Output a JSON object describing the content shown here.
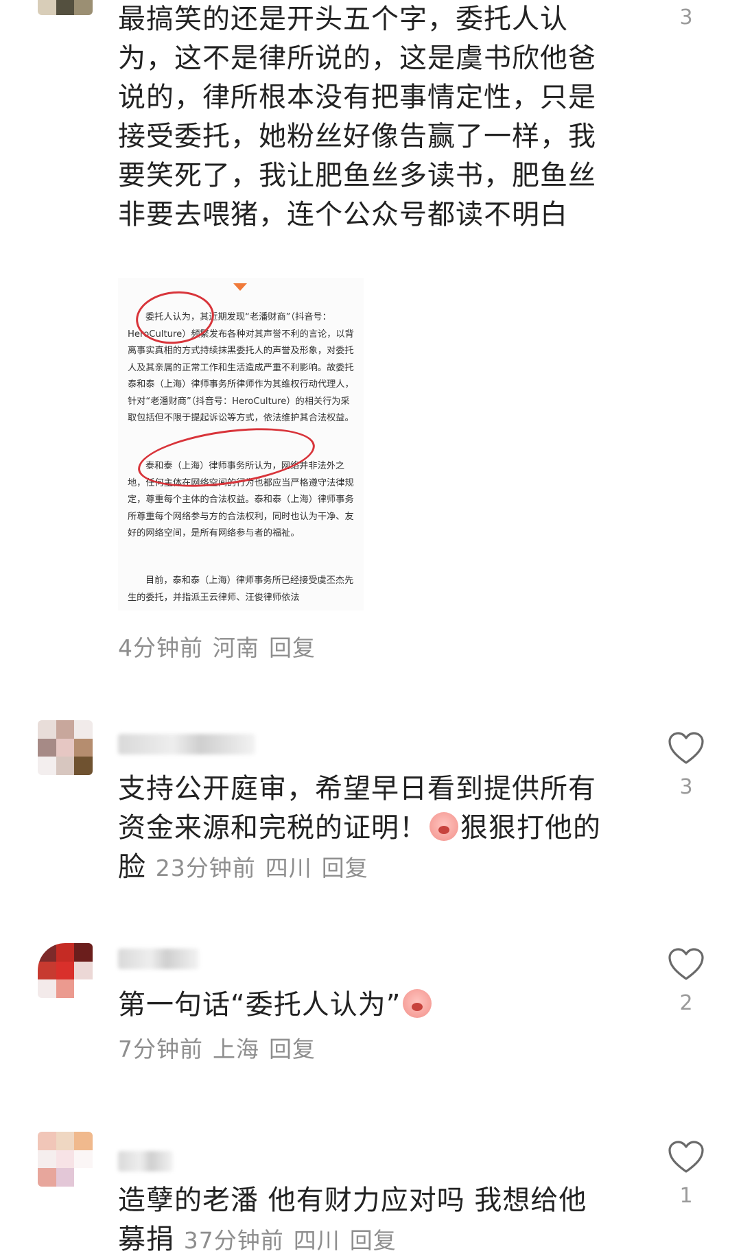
{
  "comments": [
    {
      "text": "最搞笑的还是开头五个字，委托人认为，这不是律所说的，这是虞书欣他爸说的，律所根本没有把事情定性，只是接受委托，她粉丝好像告赢了一样，我要笑死了，我让肥鱼丝多读书，肥鱼丝非要去喂猪，连个公众号都读不明白",
      "likes": "3",
      "time": "4分钟前",
      "location": "河南",
      "reply": "回复"
    },
    {
      "text_before": "支持公开庭审，希望早日看到提供所有资金来源和完税的证明！",
      "emoji": "angry-face-emoji",
      "text_after": "狠狠打他的脸",
      "likes": "3",
      "time": "23分钟前",
      "location": "四川",
      "reply": "回复"
    },
    {
      "text": "第一句话“委托人认为”",
      "emoji": "crying-face-emoji",
      "likes": "2",
      "time": "7分钟前",
      "location": "上海",
      "reply": "回复"
    },
    {
      "text": "造孽的老潘 他有财力应对吗 我想给他募捐",
      "likes": "1",
      "time": "37分钟前",
      "location": "四川",
      "reply": "回复"
    }
  ],
  "attached_image": {
    "paragraphs": [
      "委托人认为，其近期发现“老潘财商”（抖音号：HeroCulture）频繁发布各种对其声誉不利的言论，以背离事实真相的方式持续抹黑委托人的声誉及形象，对委托人及其亲属的正常工作和生活造成严重不利影响。故委托泰和泰（上海）律师事务所律师作为其维权行动代理人，针对“老潘财商”（抖音号：HeroCulture）的相关行为采取包括但不限于提起诉讼等方式，依法维护其合法权益。",
      "泰和泰（上海）律师事务所认为，网络并非法外之地，任何主体在网络空间的行为也都应当严格遵守法律规定，尊重每个主体的合法权益。泰和泰（上海）律师事务所尊重每个网络参与方的合法权利，同时也认为干净、友好的网络空间，是所有网络参与者的福祉。",
      "目前，泰和泰（上海）律师事务所已经接受虞丕杰先生的委托，并指派王云律师、汪俊律师依法"
    ]
  },
  "colors": {
    "text": "#222222",
    "meta": "#8e8e8e",
    "annotation": "#d8343a",
    "arrow": "#f07a3a"
  }
}
